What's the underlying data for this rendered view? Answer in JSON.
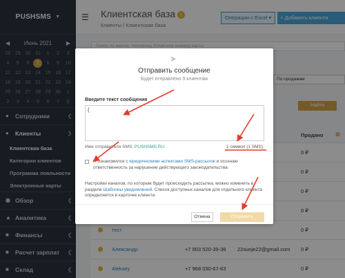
{
  "brand": {
    "name": "PUSHSMS"
  },
  "calendar": {
    "month_label": "Июнь 2021",
    "days": [
      "28",
      "29",
      "30",
      "31",
      "1",
      "2",
      "3",
      "4",
      "5",
      "6",
      "7",
      "8",
      "9",
      "10",
      "11",
      "12",
      "13",
      "14",
      "15",
      "16",
      "17",
      "18",
      "19",
      "20",
      "21",
      "22",
      "23",
      "24",
      "25",
      "26",
      "27",
      "28",
      "29",
      "30",
      "1",
      "2",
      "3",
      "4",
      "5",
      "6",
      "7",
      "8"
    ],
    "today_index": 10
  },
  "sidebar": {
    "items": [
      {
        "label": "Сотрудники",
        "icon": "user-icon"
      },
      {
        "label": "Клиенты",
        "icon": "users-icon",
        "active": true
      },
      {
        "label": "Обзор",
        "icon": "eye-icon"
      },
      {
        "label": "Аналитика",
        "icon": "chart-icon"
      },
      {
        "label": "Финансы",
        "icon": "money-icon"
      },
      {
        "label": "Расчет зарплат",
        "icon": "wallet-icon"
      },
      {
        "label": "Склад",
        "icon": "box-icon"
      }
    ],
    "sub_items": [
      "Клиентская база",
      "Категории клиентов",
      "Программа лояльности",
      "Электронные карты"
    ]
  },
  "header": {
    "title": "Клиентская база",
    "breadcrumb_root": "Клиенты",
    "breadcrumb_sep": "/",
    "breadcrumb_current": "Клиентская база",
    "excel_label": "Операции с Excel",
    "add_label": "+ Добавить клиента"
  },
  "search": {
    "placeholder": "Поиск по имени, телефону, Email или номеру карты"
  },
  "filters": {
    "sort_value": "По продажам",
    "find_label": "Найти"
  },
  "table": {
    "sold_header": "Продано",
    "rows": [
      {
        "name": "",
        "phone": "",
        "email": "",
        "sold": "0 ₽"
      },
      {
        "name": "",
        "phone": "",
        "email": "",
        "sold": "0 ₽"
      },
      {
        "name": "",
        "phone": "",
        "email": "",
        "sold": "0 ₽"
      },
      {
        "name": "",
        "phone": "",
        "email": "",
        "sold": "0 ₽"
      },
      {
        "name": "тест",
        "phone": "",
        "email": "",
        "sold": "0 ₽"
      },
      {
        "name": "Александр",
        "phone": "+7 903 520-39-38",
        "email": "22sunje22@gmail.com",
        "sold": "0 ₽"
      },
      {
        "name": "Aleksey",
        "phone": "+7 968 030-67-63",
        "email": "",
        "sold": "0 ₽"
      }
    ]
  },
  "modal": {
    "title": "Отправить сообщение",
    "subtitle": "Будет отправлено 9 клиентам",
    "field_label": "Введите текст сообщения",
    "message_value": "{",
    "sender_prefix": "Имя отправителя SMS:",
    "sender_name": "PUSHSMS.RU",
    "counter": "1 символ (1 SMS)",
    "consent_before": "Я ознакомился с",
    "consent_link": "юридическими аспектами SMS-рассылок",
    "consent_after": "и осознаю ответственность за нарушение действующего законодательства",
    "info_before": "Настройки каналов, по которым будет происходить рассылка, можно изменить в разделе",
    "info_link": "Шаблоны уведомлений",
    "info_after": ". Список доступных каналов для отдельного клиента определяется в карточке клиента.",
    "cancel_label": "Отмена",
    "send_label": "Отправить"
  },
  "colors": {
    "sidebar_bg": "#2b3440",
    "accent_gold": "#d4a54a",
    "link_blue": "#2f7fb5",
    "annotation_red": "#e23b2a"
  }
}
